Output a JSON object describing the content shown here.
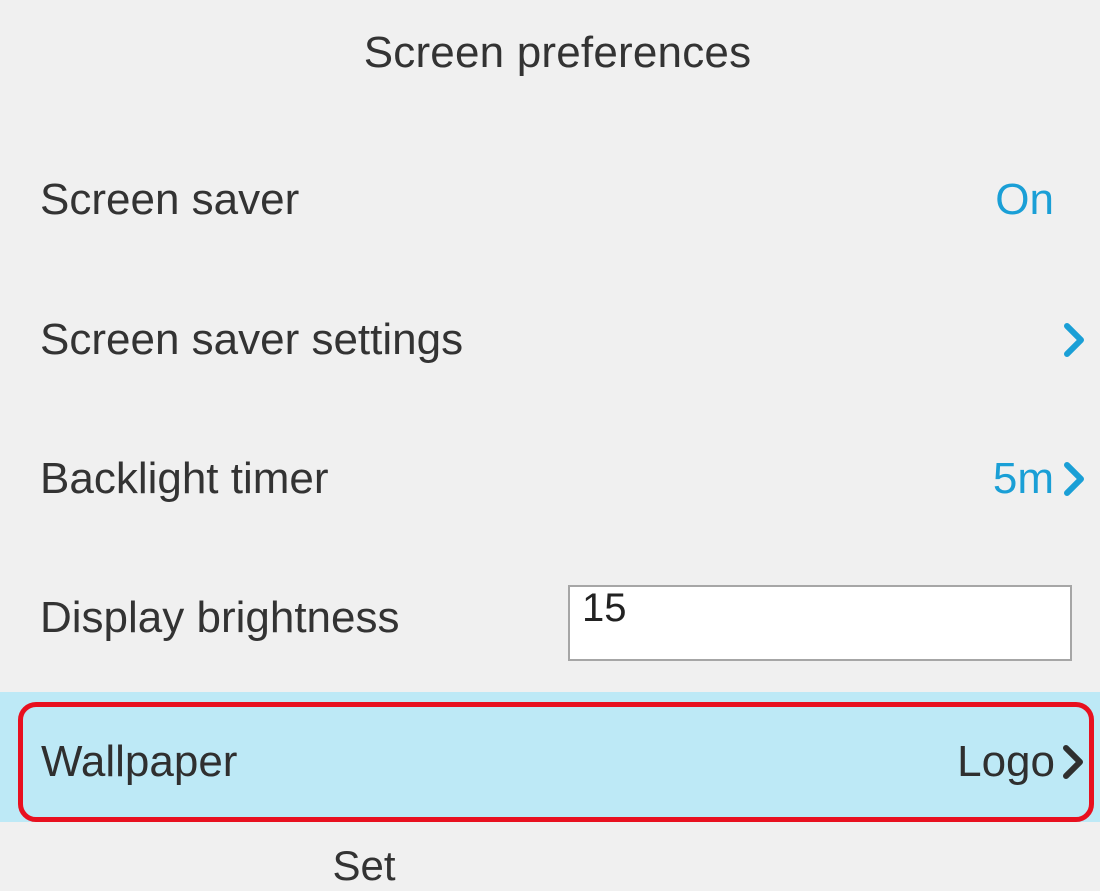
{
  "header": {
    "title": "Screen preferences"
  },
  "menu": {
    "screen_saver": {
      "label": "Screen saver",
      "value": "On"
    },
    "screen_saver_settings": {
      "label": "Screen saver settings"
    },
    "backlight_timer": {
      "label": "Backlight timer",
      "value": "5m"
    },
    "display_brightness": {
      "label": "Display brightness",
      "value": "15"
    },
    "wallpaper": {
      "label": "Wallpaper",
      "value": "Logo",
      "selected": true
    }
  },
  "softkeys": {
    "set_label": "Set"
  },
  "colors": {
    "background": "#f0f0f0",
    "accent": "#1a9fd6",
    "selected_row": "#bde9f6",
    "highlight_border": "#e8101f",
    "text": "#333333"
  },
  "icons": {
    "chevron": "chevron-right-icon"
  }
}
